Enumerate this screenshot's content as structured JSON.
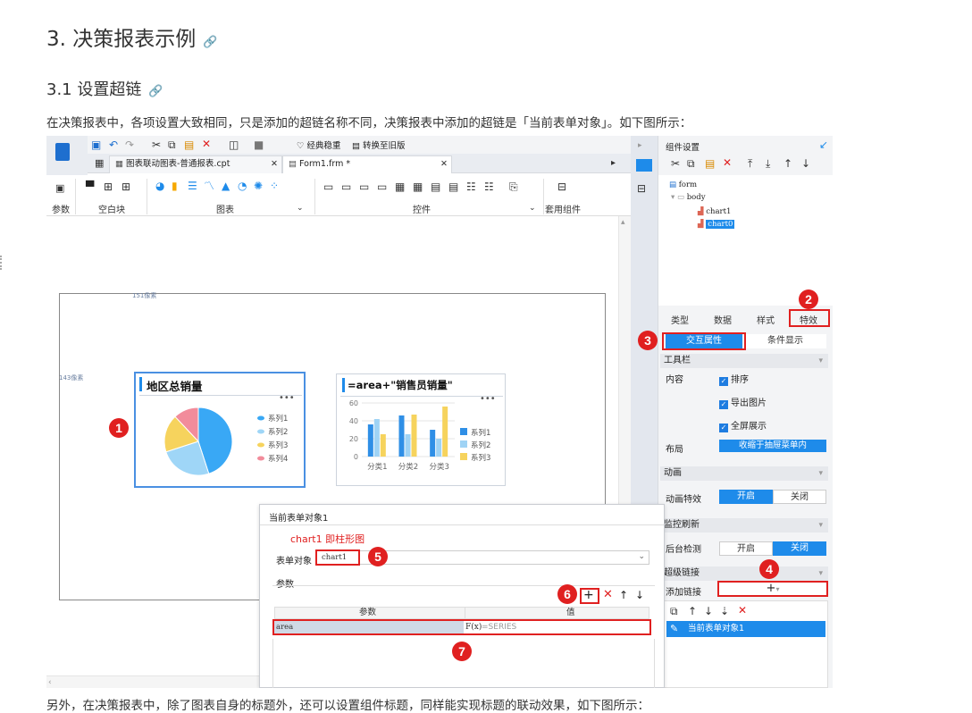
{
  "article": {
    "h2": "3. 决策报表示例",
    "h3": "3.1 设置超链",
    "anchor_glyph": "🔗",
    "para": "在决策报表中，各项设置大致相同，只是添加的超链名称不同，决策报表中添加的超链是「当前表单对象」。如下图所示：",
    "para2": "另外，在决策报表中，除了图表自身的标题外，还可以设置组件标题，同样能实现标题的联动效果，如下图所示："
  },
  "designer": {
    "toolbar": {
      "classic": "经典稳重",
      "switch_old": "转换至旧版"
    },
    "tabs": [
      {
        "label": "图表联动图表-普通报表.cpt"
      },
      {
        "label": "Form1.frm *"
      }
    ],
    "ribbon": {
      "param": "参数",
      "blank": "空白块",
      "chart": "图表",
      "widget": "控件",
      "reuse": "套用组件"
    },
    "canvas": {
      "width_label": "151像素",
      "height_label": "143像素"
    },
    "chart1": {
      "title": "地区总销量",
      "legend": [
        "系列1",
        "系列2",
        "系列3",
        "系列4"
      ]
    },
    "chart2": {
      "title": "=area+\"销售员销量\"",
      "y_ticks": [
        "60",
        "40",
        "20",
        "0"
      ],
      "categories": [
        "分类1",
        "分类2",
        "分类3"
      ],
      "legend": [
        "系列1",
        "系列2",
        "系列3"
      ]
    }
  },
  "chart_data": [
    {
      "type": "pie",
      "title": "地区总销量",
      "labels": [
        "系列1",
        "系列2",
        "系列3",
        "系列4"
      ],
      "values": [
        45,
        25,
        18,
        12
      ],
      "colors": [
        "#39a8f5",
        "#9fd6f7",
        "#f6d35d",
        "#f28c9b"
      ]
    },
    {
      "type": "bar",
      "title": "=area+\"销售员销量\"",
      "categories": [
        "分类1",
        "分类2",
        "分类3"
      ],
      "series": [
        {
          "name": "系列1",
          "values": [
            36,
            46,
            30
          ]
        },
        {
          "name": "系列2",
          "values": [
            42,
            25,
            20
          ]
        },
        {
          "name": "系列3",
          "values": [
            25,
            47,
            56
          ]
        }
      ],
      "ylim": [
        0,
        60
      ],
      "colors": [
        "#2f8fe6",
        "#9fd3f5",
        "#f6d35d"
      ]
    }
  ],
  "right_panel": {
    "title": "组件设置",
    "tree": [
      "form",
      "body",
      "chart1",
      "chart0"
    ],
    "tabs": [
      "类型",
      "数据",
      "样式",
      "特效"
    ],
    "subtabs": [
      "交互属性",
      "条件显示"
    ],
    "toolbar_section": "工具栏",
    "content_label": "内容",
    "checks": [
      "排序",
      "导出图片",
      "全屏展示"
    ],
    "layout_label": "布局",
    "layout_value": "收缩于抽屉菜单内",
    "anim_section": "动画",
    "anim_label": "动画特效",
    "on": "开启",
    "off": "关闭",
    "monitor_section": "监控刷新",
    "monitor_label": "后台检测",
    "link_section": "超级链接",
    "add_link": "添加链接",
    "link_item": "当前表单对象1"
  },
  "dialog": {
    "title": "当前表单对象1",
    "note": "chart1 即柱形图",
    "form_obj_label": "表单对象",
    "form_obj_value": "chart1",
    "params_label": "参数",
    "col_param": "参数",
    "col_value": "值",
    "row_param": "area",
    "row_fx": "F(x)",
    "row_value": "=SERIES"
  },
  "badges": [
    "1",
    "2",
    "3",
    "4",
    "5",
    "6",
    "7"
  ]
}
